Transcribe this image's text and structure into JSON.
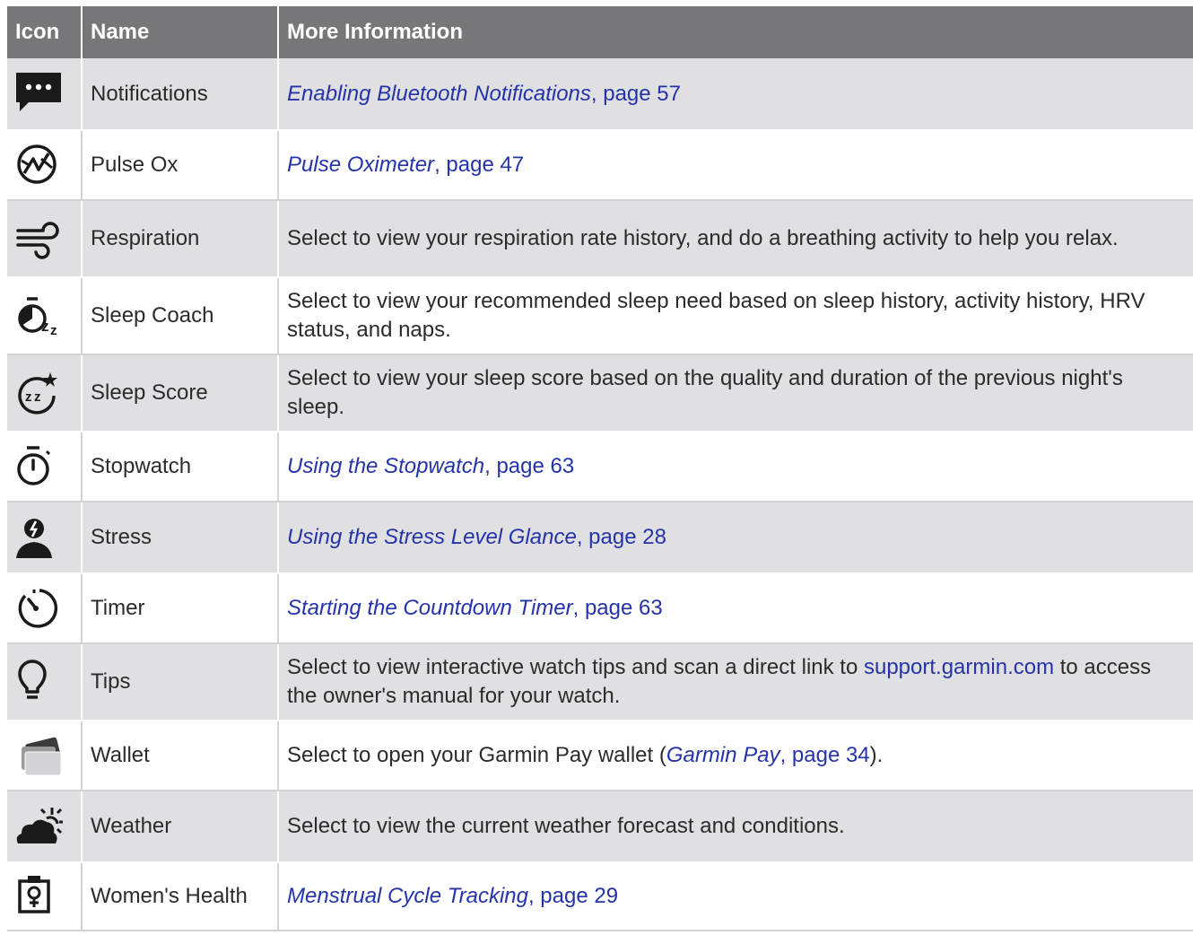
{
  "headers": {
    "icon": "Icon",
    "name": "Name",
    "info": "More Information"
  },
  "rows": [
    {
      "icon": "notification-bubble-icon",
      "name": "Notifications",
      "ref": "Enabling Bluetooth Notifications",
      "page": ", page 57"
    },
    {
      "icon": "pulse-ox-icon",
      "name": "Pulse Ox",
      "ref": "Pulse Oximeter",
      "page": ", page 47"
    },
    {
      "icon": "respiration-icon",
      "name": "Respiration",
      "text": "Select to view your respiration rate history, and do a breathing activity to help you relax."
    },
    {
      "icon": "sleep-coach-icon",
      "name": "Sleep Coach",
      "text": "Select to view your recommended sleep need based on sleep history, activity history, HRV status, and naps."
    },
    {
      "icon": "sleep-score-icon",
      "name": "Sleep Score",
      "text": "Select to view your sleep score based on the quality and duration of the previous night's sleep."
    },
    {
      "icon": "stopwatch-icon",
      "name": "Stopwatch",
      "ref": "Using the Stopwatch",
      "page": ", page 63"
    },
    {
      "icon": "stress-icon",
      "name": "Stress",
      "ref": "Using the Stress Level Glance",
      "page": ", page 28"
    },
    {
      "icon": "timer-icon",
      "name": "Timer",
      "ref": "Starting the Countdown Timer",
      "page": ", page 63"
    },
    {
      "icon": "lightbulb-icon",
      "name": "Tips",
      "text_before": "Select to view interactive watch tips and scan a direct link to ",
      "link": "support.garmin.com",
      "text_after": " to access the owner's manual for your watch."
    },
    {
      "icon": "wallet-cards-icon",
      "name": "Wallet",
      "text_before": "Select to open your Garmin Pay wallet (",
      "ref": "Garmin Pay",
      "page": ", page 34",
      "text_after": ")."
    },
    {
      "icon": "weather-icon",
      "name": "Weather",
      "text": "Select to view the current weather forecast and conditions."
    },
    {
      "icon": "womens-health-icon",
      "name": "Women's Health",
      "ref": "Menstrual Cycle Tracking",
      "page": ", page 29"
    }
  ],
  "colors": {
    "header_bg": "#77777b",
    "shade_bg": "#e0e0e3",
    "link": "#2433a7"
  }
}
